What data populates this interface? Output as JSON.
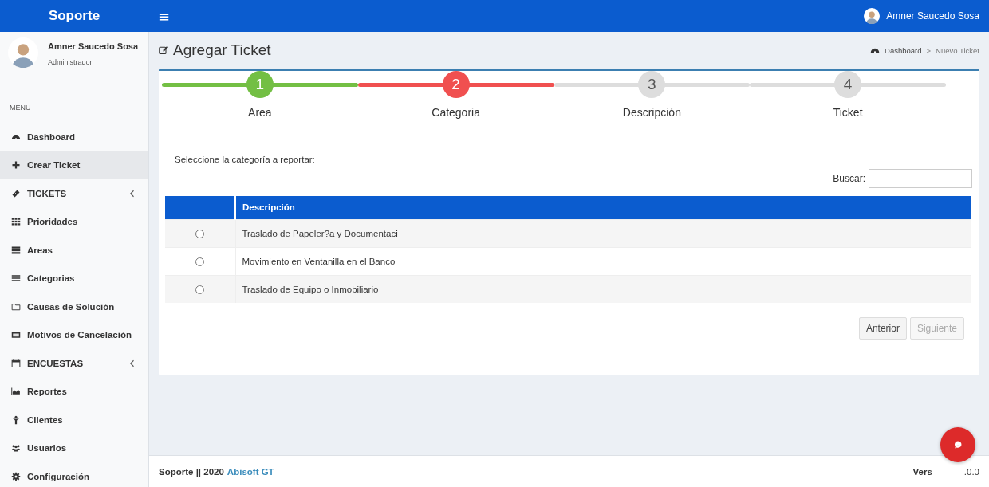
{
  "topbar": {
    "brand": "Soporte",
    "menu_toggle": "≡",
    "user": "Amner Saucedo Sosa"
  },
  "sidebar": {
    "user": {
      "name": "Amner Saucedo Sosa",
      "role": "Administrador"
    },
    "header": "MENU",
    "items": [
      {
        "label": "Dashboard",
        "kind": "link",
        "selected": false
      },
      {
        "label": "Crear Ticket",
        "kind": "link",
        "selected": true
      },
      {
        "label": "TICKETS",
        "kind": "group",
        "selected": false
      },
      {
        "label": "Prioridades",
        "kind": "link",
        "selected": false
      },
      {
        "label": "Areas",
        "kind": "link",
        "selected": false
      },
      {
        "label": "Categorias",
        "kind": "link",
        "selected": false
      },
      {
        "label": "Causas de Solución",
        "kind": "link",
        "selected": false
      },
      {
        "label": "Motivos de Cancelación",
        "kind": "link",
        "selected": false
      },
      {
        "label": "ENCUESTAS",
        "kind": "group",
        "selected": false
      },
      {
        "label": "Reportes",
        "kind": "link",
        "selected": false
      },
      {
        "label": "Clientes",
        "kind": "link",
        "selected": false
      },
      {
        "label": "Usuarios",
        "kind": "link",
        "selected": false
      },
      {
        "label": "Configuración",
        "kind": "link",
        "selected": false
      }
    ]
  },
  "page": {
    "title": "Agregar Ticket",
    "breadcrumb": [
      "Dashboard",
      "Nuevo Ticket"
    ],
    "breadcrumb_separator": ">"
  },
  "steps": [
    {
      "number": "1",
      "label": "Area",
      "done": true,
      "active": false
    },
    {
      "number": "2",
      "label": "Categoria",
      "done": false,
      "active": true
    },
    {
      "number": "3",
      "label": "Descripción",
      "done": false,
      "active": false
    },
    {
      "number": "4",
      "label": "Ticket",
      "done": false,
      "active": false
    }
  ],
  "instruction": "Seleccione la categoría a reportar:",
  "search": {
    "label": "Buscar:"
  },
  "table": {
    "columns": [
      "Descripción"
    ],
    "rows": [
      {
        "selected": false,
        "description": "Traslado de Papeler?a y Documentaci"
      },
      {
        "selected": false,
        "description": "Movimiento en Ventanilla en el Banco"
      },
      {
        "selected": false,
        "description": "Traslado de Equipo o Inmobiliario"
      }
    ]
  },
  "buttons": [
    {
      "label": "Anterior",
      "disabled": false
    },
    {
      "label": "Siguiente",
      "disabled": true
    }
  ],
  "footer": {
    "brand": "Soporte || 2020",
    "link": "Abisoft GT",
    "version_start": "Vers",
    "version_end": ".0.0"
  }
}
